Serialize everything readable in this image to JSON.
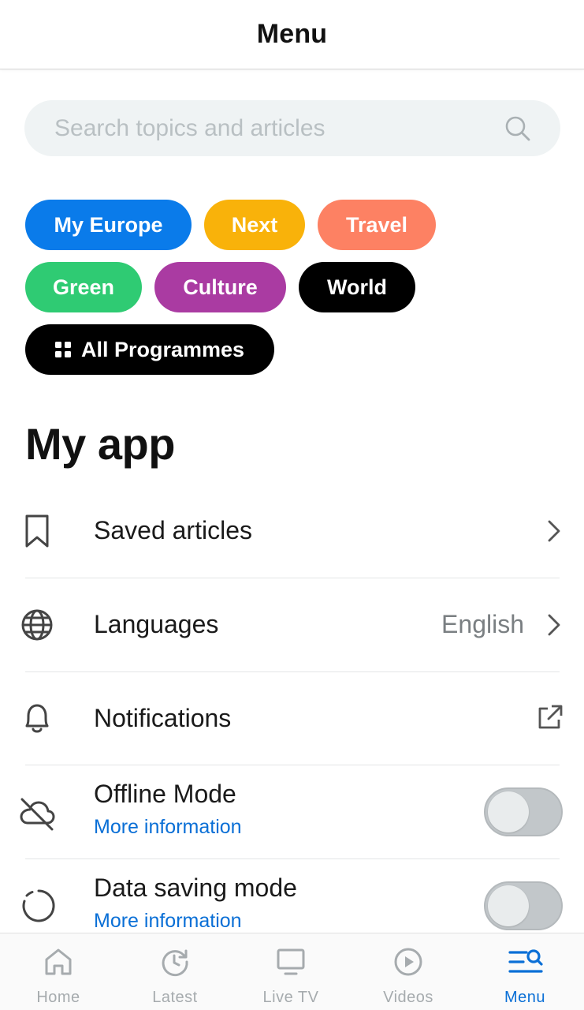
{
  "header": {
    "title": "Menu"
  },
  "search": {
    "placeholder": "Search topics and articles"
  },
  "chips": [
    {
      "label": "My Europe",
      "color": "#0a7bea"
    },
    {
      "label": "Next",
      "color": "#f9b20a"
    },
    {
      "label": "Travel",
      "color": "#fd8163"
    },
    {
      "label": "Green",
      "color": "#2fcb73"
    },
    {
      "label": "Culture",
      "color": "#aa3ba2"
    },
    {
      "label": "World",
      "color": "#000000"
    },
    {
      "label": "All Programmes",
      "color": "#000000",
      "icon": "grid-icon"
    }
  ],
  "my_app": {
    "title": "My app",
    "items": [
      {
        "label": "Saved articles",
        "icon": "bookmark-icon",
        "action": "chevron-right-icon"
      },
      {
        "label": "Languages",
        "icon": "globe-icon",
        "value": "English",
        "action": "chevron-right-icon"
      },
      {
        "label": "Notifications",
        "icon": "bell-icon",
        "action": "external-link-icon"
      },
      {
        "label": "Offline Mode",
        "icon": "cloud-off-icon",
        "link": "More information",
        "toggle": false
      },
      {
        "label": "Data saving mode",
        "icon": "data-saving-icon",
        "link": "More information",
        "toggle": false
      }
    ]
  },
  "bottom_nav": {
    "active": "Menu",
    "active_color": "#0a6fd6",
    "items": [
      {
        "label": "Home",
        "icon": "home-icon"
      },
      {
        "label": "Latest",
        "icon": "clock-history-icon"
      },
      {
        "label": "Live TV",
        "icon": "tv-icon"
      },
      {
        "label": "Videos",
        "icon": "play-circle-icon"
      },
      {
        "label": "Menu",
        "icon": "menu-search-icon"
      }
    ]
  }
}
